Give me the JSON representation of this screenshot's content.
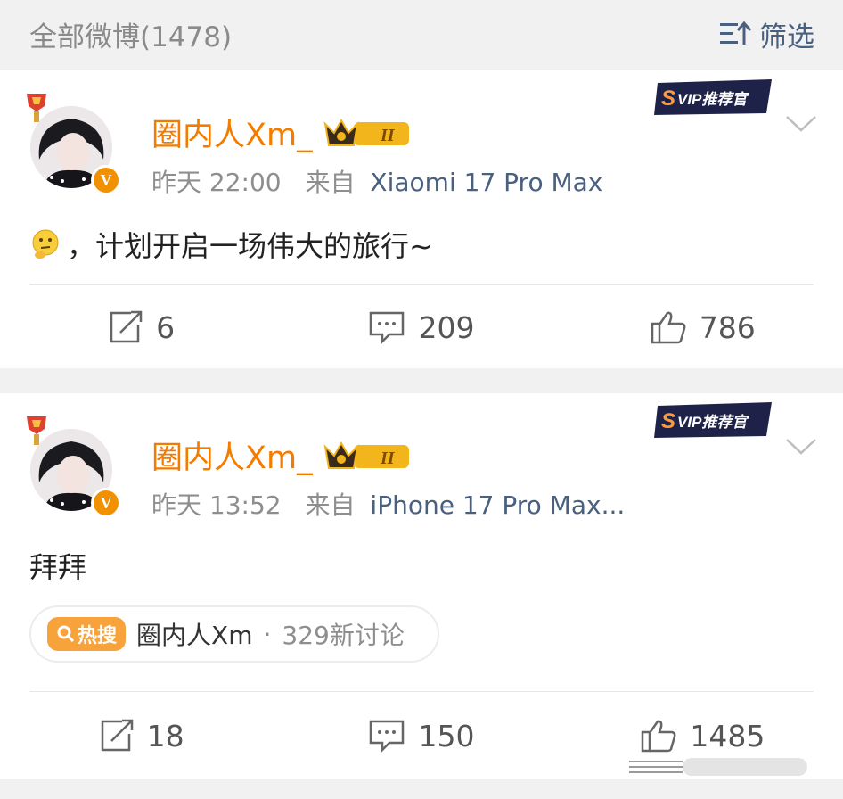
{
  "header": {
    "count_label": "全部微博(1478)",
    "filter_label": "筛选"
  },
  "posts": [
    {
      "author": "圈内人Xm_",
      "time": "昨天 22:00",
      "from_label": "来自",
      "device": "Xiaomi 17 Pro Max",
      "text": "，计划开启一场伟大的旅行~",
      "emoji": "thinking-face",
      "svip_badge": "SVIP推荐官",
      "stats": {
        "reposts": "6",
        "comments": "209",
        "likes": "786"
      }
    },
    {
      "author": "圈内人Xm_",
      "time": "昨天 13:52",
      "from_label": "来自",
      "device": "iPhone 17 Pro Max...",
      "text": "拜拜",
      "svip_badge": "SVIP推荐官",
      "hot_tag": {
        "badge": "热搜",
        "topic": "圈内人Xm",
        "sep": "·",
        "discussion": "329新讨论"
      },
      "stats": {
        "reposts": "18",
        "comments": "150",
        "likes": "1485"
      }
    }
  ],
  "colors": {
    "name": "#f37c00",
    "device": "#4a607f",
    "hot": "#f7a23a",
    "vip_gold": "#f2b51c"
  }
}
